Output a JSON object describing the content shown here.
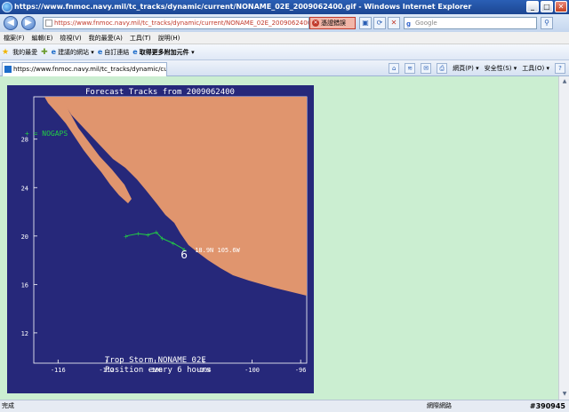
{
  "window": {
    "title": "https://www.fnmoc.navy.mil/tc_tracks/dynamic/current/NONAME_02E_2009062400.gif - Windows Internet Explorer"
  },
  "address": {
    "url": "https://www.fnmoc.navy.mil/tc_tracks/dynamic/current/NONAME_02E_2009062400.gif",
    "cert_error": "憑證錯誤"
  },
  "search": {
    "placeholder": "Google"
  },
  "menu": [
    "檔案(F)",
    "編輯(E)",
    "檢視(V)",
    "我的最愛(A)",
    "工具(T)",
    "說明(H)"
  ],
  "favorites": {
    "label": "我的最愛",
    "items": [
      "建議的網站 ▾",
      "自訂連結",
      "取得更多附加元件 ▾"
    ]
  },
  "tab": {
    "title": "https://www.fnmoc.navy.mil/tc_tracks/dynamic/current..."
  },
  "commands": [
    "網頁(P) ▾",
    "安全性(S) ▾",
    "工具(O) ▾"
  ],
  "status": {
    "left": "完成",
    "zone": "網際網路",
    "zoom": "#390945"
  },
  "chart_data": {
    "type": "map",
    "title": "Forecast Tracks from 2009062400",
    "legend": "+ = NOGAPS",
    "x_ticks": [
      "-116",
      "-112",
      "-108",
      "-104",
      "-100",
      "-96"
    ],
    "y_ticks": [
      "28",
      "24",
      "20",
      "16",
      "12"
    ],
    "storm_position": "18.9N 105.6W",
    "storm_symbol": "6",
    "footer": [
      "Trop Storm NONAME 02E",
      "Position every 6 hours"
    ],
    "track": [
      [
        -105.6,
        18.9
      ],
      [
        -106.5,
        19.4
      ],
      [
        -107.4,
        19.8
      ],
      [
        -107.9,
        20.3
      ],
      [
        -108.6,
        20.1
      ],
      [
        -109.4,
        20.2
      ],
      [
        -110.4,
        20.0
      ]
    ],
    "xlim": [
      -118,
      -95.5
    ],
    "ylim": [
      9.5,
      31.5
    ],
    "colors": {
      "ocean": "#26287a",
      "land": "#e0956e",
      "track": "#22cc44",
      "text": "#ffffff"
    }
  }
}
